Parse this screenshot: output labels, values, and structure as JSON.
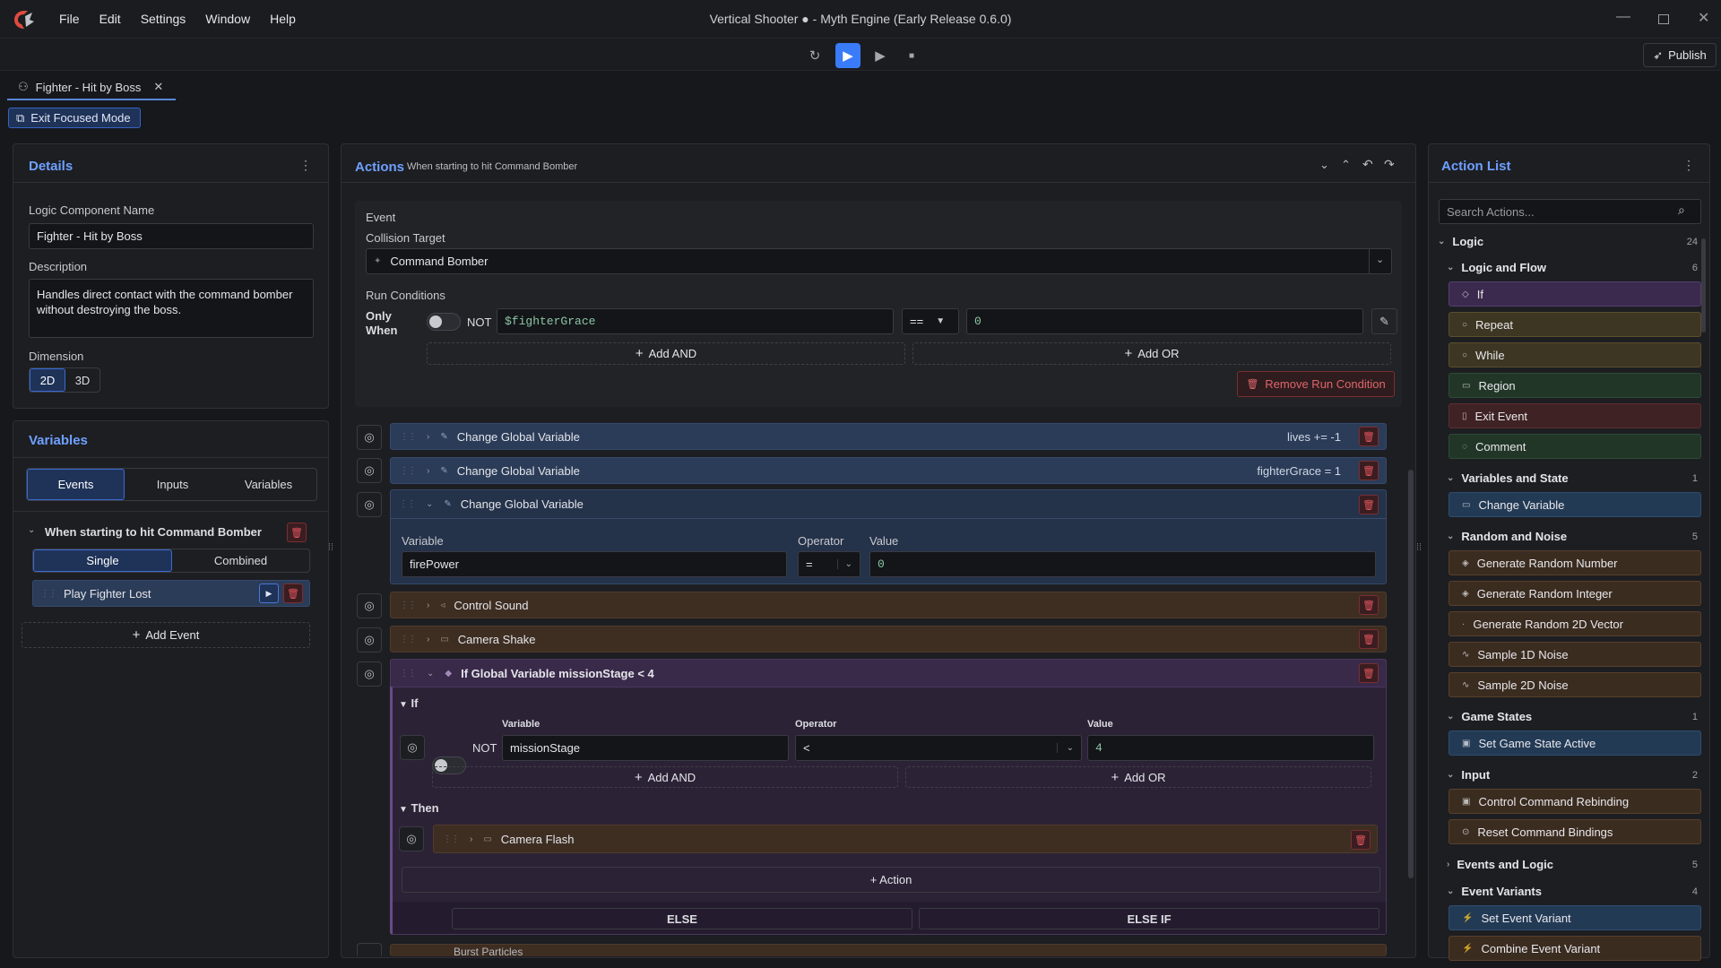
{
  "menu": [
    "File",
    "Edit",
    "Settings",
    "Window",
    "Help"
  ],
  "window_title": "Vertical Shooter ● - Myth Engine (Early Release 0.6.0)",
  "publish_label": "Publish",
  "tab": {
    "label": "Fighter - Hit by Boss"
  },
  "exit_focus_label": "Exit Focused Mode",
  "details": {
    "title": "Details",
    "name_label": "Logic Component Name",
    "name_value": "Fighter - Hit by Boss",
    "desc_label": "Description",
    "desc_value": "Handles direct contact with the command bomber without destroying the boss.",
    "dim_label": "Dimension",
    "dim_2d": "2D",
    "dim_3d": "3D"
  },
  "variables": {
    "title": "Variables",
    "tabs": [
      "Events",
      "Inputs",
      "Variables"
    ],
    "event_title": "When starting to hit Command Bomber",
    "mode_single": "Single",
    "mode_combined": "Combined",
    "action_item": "Play Fighter Lost",
    "add_event": "Add Event"
  },
  "actions": {
    "title": "Actions",
    "subtitle": "When starting to hit Command Bomber",
    "event_label": "Event",
    "collision_label": "Collision Target",
    "collision_value": "Command Bomber",
    "run_conditions": "Run Conditions",
    "only_when": "Only When",
    "not": "NOT",
    "cond_var": "$fighterGrace",
    "cond_op": "==",
    "cond_val": "0",
    "add_and": "Add AND",
    "add_or": "Add OR",
    "remove_run": "Remove Run Condition",
    "rows": [
      {
        "label": "Change Global Variable",
        "summary": "lives += -1"
      },
      {
        "label": "Change Global Variable",
        "summary": "fighterGrace = 1"
      },
      {
        "label": "Change Global Variable",
        "summary": ""
      }
    ],
    "expanded": {
      "var_label": "Variable",
      "op_label": "Operator",
      "val_label": "Value",
      "var_value": "firePower",
      "op_value": "=",
      "val_value": "0"
    },
    "control_sound": "Control Sound",
    "camera_shake": "Camera Shake",
    "if_row": "If Global Variable missionStage < 4",
    "if_label": "If",
    "if_var_label": "Variable",
    "if_op_label": "Operator",
    "if_val_label": "Value",
    "if_var": "missionStage",
    "if_op": "<",
    "if_val": "4",
    "then_label": "Then",
    "camera_flash": "Camera Flash",
    "add_action": "+ Action",
    "else": "ELSE",
    "else_if": "ELSE IF",
    "burst": "Burst Particles"
  },
  "action_list": {
    "title": "Action List",
    "search_placeholder": "Search Actions...",
    "logic": "Logic",
    "logic_count": "24",
    "cat_flow": "Logic and Flow",
    "cat_flow_count": "6",
    "flow_items": [
      "If",
      "Repeat",
      "While",
      "Region",
      "Exit Event",
      "Comment"
    ],
    "cat_vars": "Variables and State",
    "cat_vars_count": "1",
    "vars_items": [
      "Change Variable"
    ],
    "cat_random": "Random and Noise",
    "cat_random_count": "5",
    "random_items": [
      "Generate Random Number",
      "Generate Random Integer",
      "Generate Random 2D Vector",
      "Sample 1D Noise",
      "Sample 2D Noise"
    ],
    "cat_states": "Game States",
    "cat_states_count": "1",
    "states_items": [
      "Set Game State Active"
    ],
    "cat_input": "Input",
    "cat_input_count": "2",
    "input_items": [
      "Control Command Rebinding",
      "Reset Command Bindings"
    ],
    "cat_evlogic": "Events and Logic",
    "cat_evlogic_count": "5",
    "cat_variants": "Event Variants",
    "cat_variants_count": "4",
    "variant_items": [
      "Set Event Variant",
      "Combine Event Variant"
    ]
  }
}
